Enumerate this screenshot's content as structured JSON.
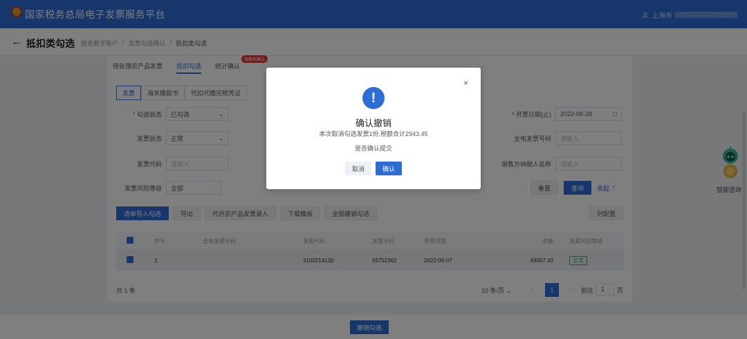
{
  "header": {
    "title": "国家税务总局电子发票服务平台",
    "user_prefix": "上海市"
  },
  "page": {
    "title": "抵扣类勾选",
    "breadcrumb": [
      "税务数字账户",
      "发票勾选确认",
      "抵扣类勾选"
    ]
  },
  "tabs": [
    "待处理农产品发票",
    "抵扣勾选",
    "统计确认"
  ],
  "tab_badge": "当期未确认",
  "subtabs": [
    "发票",
    "海关缴款书",
    "代扣代缴完税凭证"
  ],
  "filters": [
    {
      "label": "勾选状态",
      "required": true,
      "value": "已勾选",
      "type": "select"
    },
    {
      "label": "开票日期(止)",
      "required": true,
      "value": "2022-06-28",
      "type": "date"
    },
    {
      "label": "发票状态",
      "required": false,
      "value": "正常",
      "type": "select"
    },
    {
      "label": "全电发票号码",
      "required": false,
      "placeholder": "请输入",
      "type": "text"
    },
    {
      "label": "发票代码",
      "required": false,
      "placeholder": "请输入",
      "type": "text"
    },
    {
      "label": "销售方纳税人名称",
      "required": false,
      "placeholder": "请输入",
      "type": "text"
    },
    {
      "label": "发票风险等级",
      "required": false,
      "value": "全部",
      "type": "select"
    }
  ],
  "filter_actions": {
    "reset": "重置",
    "query": "查询",
    "collapse": "收起"
  },
  "toolbar": [
    "清单导入勾选",
    "导出",
    "代开农产品发票录入",
    "下载模板",
    "全部撤销勾选"
  ],
  "column_config": "列配置",
  "table": {
    "columns": [
      "序号",
      "全电发票号码",
      "发票代码",
      "发票号码",
      "开票日期",
      "金额",
      "发票风险等级"
    ],
    "rows": [
      {
        "index": "1",
        "full_no": "",
        "code": "3100214130",
        "number": "55752362",
        "date": "2022-06-07",
        "amount": "49057.43",
        "risk": "正常"
      }
    ]
  },
  "pagination": {
    "total": "共 1 条",
    "page_size": "10 条/页",
    "current": "1",
    "goto_label": "前往",
    "goto_value": "1",
    "goto_suffix": "页"
  },
  "footer": {
    "button": "撤销勾选"
  },
  "assistant": {
    "label": "智能咨询"
  },
  "modal": {
    "title": "确认撤销",
    "message": "本次取消勾选发票1份,税额合计2943.45",
    "sub": "是否确认提交",
    "cancel": "取消",
    "confirm": "确认",
    "close": "×"
  },
  "colors": {
    "primary": "#2e6dd6",
    "danger": "#e03a3a",
    "success": "#36b37e"
  }
}
